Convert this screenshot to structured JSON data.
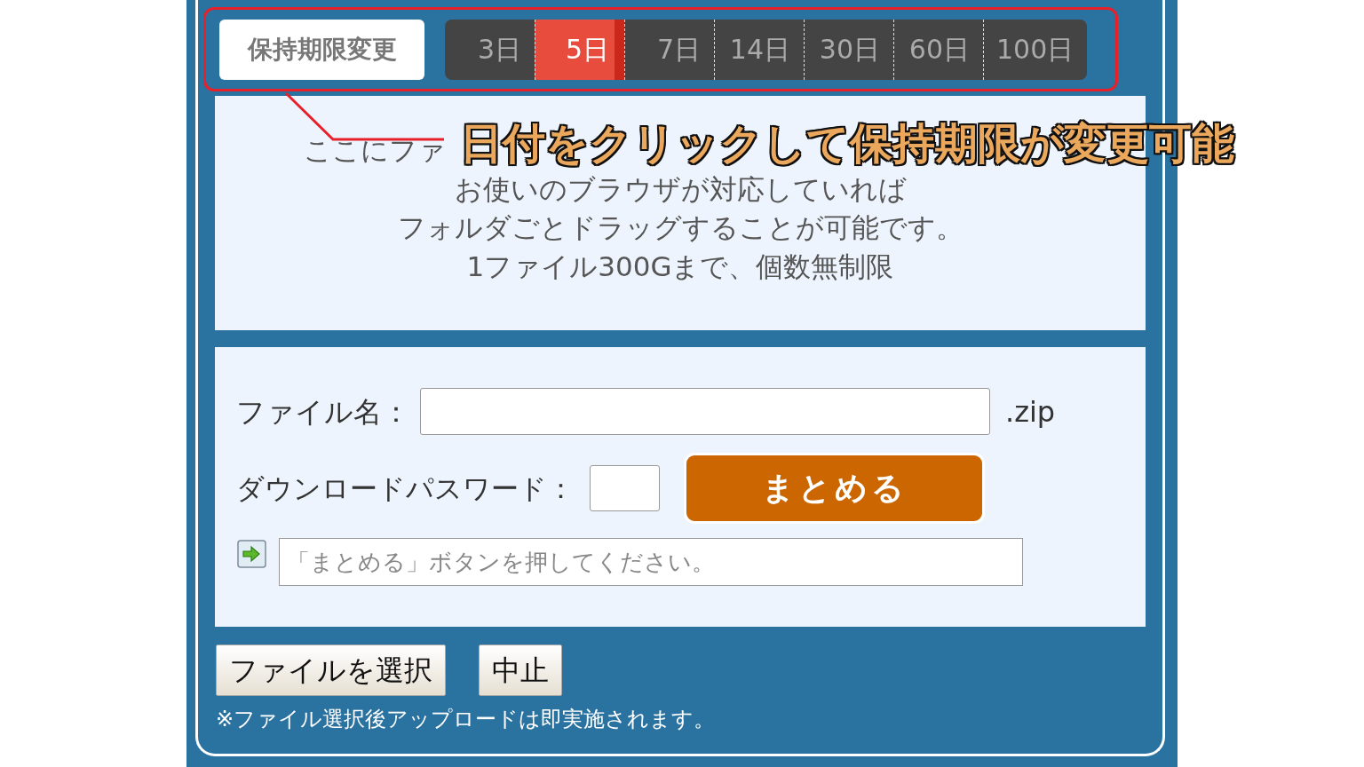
{
  "retention": {
    "label": "保持期限変更",
    "options": [
      {
        "label": "3日",
        "selected": false
      },
      {
        "label": "5日",
        "selected": true
      },
      {
        "label": "7日",
        "selected": false
      },
      {
        "label": "14日",
        "selected": false
      },
      {
        "label": "30日",
        "selected": false
      },
      {
        "label": "60日",
        "selected": false
      },
      {
        "label": "100日",
        "selected": false
      }
    ]
  },
  "annotation": {
    "text": "日付をクリックして保持期限が変更可能"
  },
  "drop_zone": {
    "lines": [
      "ここにファ",
      "お使いのブラウザが対応していれば",
      "フォルダごとドラッグすることが可能です。",
      "1ファイル300Gまで、個数無制限"
    ]
  },
  "form": {
    "filename_label": "ファイル名：",
    "filename_suffix": ".zip",
    "password_label": "ダウンロードパスワード：",
    "submit_button": "まとめる",
    "status_placeholder": "「まとめる」ボタンを押してください。"
  },
  "buttons": [
    "ファイルを選択",
    "中止"
  ],
  "note": "※ファイル選択後アップロードは即実施されます。"
}
